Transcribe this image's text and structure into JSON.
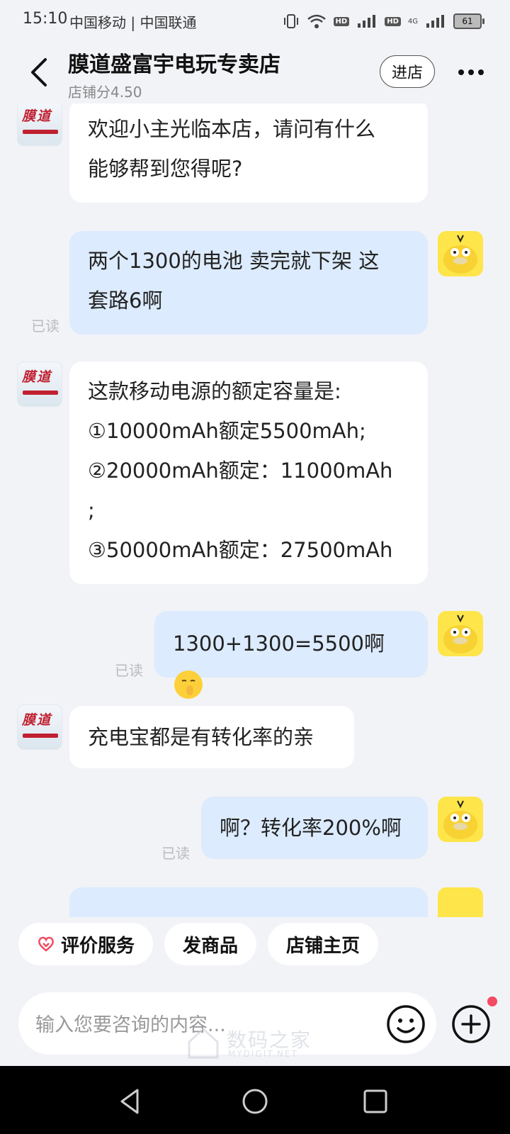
{
  "status_bar": {
    "time": "15:10",
    "carriers": "中国移动 | 中国联通",
    "network_badge": "HD",
    "network_type": "4G",
    "battery": "61"
  },
  "header": {
    "shop_name": "膜道盛富宇电玩专卖店",
    "shop_score": "店铺分4.50",
    "enter_label": "进店",
    "back_icon": "chevron-left-icon",
    "more_icon": "more-dots-icon"
  },
  "shop_logo_text": "膜道",
  "read_label": "已读",
  "messages": [
    {
      "from": "shop",
      "lines": [
        "欢迎小主光临本店，请问有什么",
        "能够帮到您得呢?"
      ]
    },
    {
      "from": "user",
      "lines": [
        "两个1300的电池 卖完就下架 这",
        "套路6啊"
      ],
      "read": "已读"
    },
    {
      "from": "shop",
      "lines": [
        "这款移动电源的额定容量是:",
        "①10000mAh额定5500mAh;",
        "②20000mAh额定：11000mAh",
        ";",
        "③50000mAh额定：27500mAh"
      ]
    },
    {
      "from": "user",
      "lines": [
        "1300+1300=5500啊"
      ],
      "emoji": "shushing-face-emoji",
      "read": "已读"
    },
    {
      "from": "shop",
      "lines": [
        "充电宝都是有转化率的亲"
      ]
    },
    {
      "from": "user",
      "lines": [
        "啊？转化率200%啊"
      ],
      "read": "已读"
    }
  ],
  "quick_actions": {
    "rate": "评价服务",
    "send_product": "发商品",
    "shop_home": "店铺主页"
  },
  "input": {
    "placeholder": "输入您要咨询的内容..."
  },
  "watermark": {
    "text": "数码之家",
    "sub": "MYDIGIT.NET"
  },
  "colors": {
    "incoming_bubble": "#ffffff",
    "outgoing_bubble": "#dcebfd",
    "background": "#f2f3f7",
    "badge": "#f24b62"
  }
}
